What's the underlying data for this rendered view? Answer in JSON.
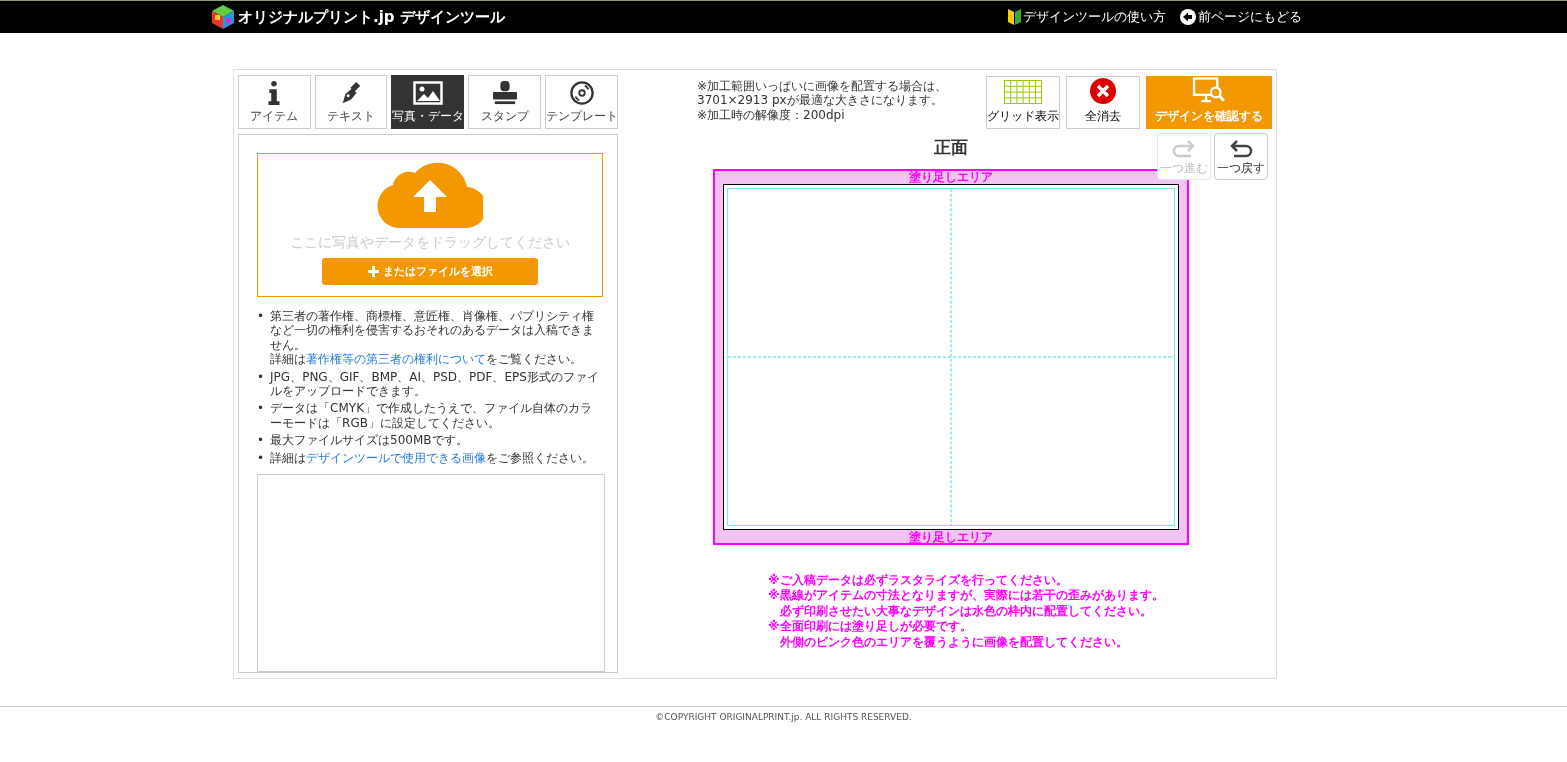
{
  "header": {
    "logo_text": "オリジナルプリント.jp デザインツール",
    "links": [
      {
        "kind": "guide",
        "label": "デザインツールの使い方"
      },
      {
        "kind": "back",
        "label": "前ページにもどる"
      }
    ]
  },
  "tabs": [
    {
      "kind": "info",
      "label": "アイテム",
      "selected": false
    },
    {
      "kind": "pen",
      "label": "テキスト",
      "selected": false
    },
    {
      "kind": "image",
      "label": "写真・データ",
      "selected": true
    },
    {
      "kind": "stamp",
      "label": "スタンプ",
      "selected": false
    },
    {
      "kind": "disc",
      "label": "テンプレート",
      "selected": false
    }
  ],
  "upload": {
    "drop_text": "ここに写真やデータをドラッグしてください",
    "button": "またはファイルを選択"
  },
  "rules": [
    {
      "bullet": "•",
      "lines": [
        [
          {
            "kind": "text",
            "text": "第三者の著作権、商標権、意匠権、肖像権、パブリシティ権など一切の権利を侵害するおそれのあるデータは入稿できません。"
          }
        ],
        [
          {
            "kind": "text",
            "text": "詳細は"
          },
          {
            "kind": "link",
            "text": "著作権等の第三者の権利について"
          },
          {
            "kind": "text",
            "text": "をご覧ください。"
          }
        ]
      ]
    },
    {
      "bullet": "•",
      "lines": [
        [
          {
            "kind": "text",
            "text": "JPG、PNG、GIF、BMP、AI、PSD、PDF、EPS形式のファイルをアップロードできます。"
          }
        ]
      ]
    },
    {
      "bullet": "•",
      "lines": [
        [
          {
            "kind": "text",
            "text": "データは「CMYK」で作成したうえで、ファイル自体のカラーモードは「RGB」に設定してください。"
          }
        ]
      ]
    },
    {
      "bullet": "•",
      "lines": [
        [
          {
            "kind": "text",
            "text": "最大ファイルサイズは500MBです。"
          }
        ]
      ]
    },
    {
      "bullet": "•",
      "lines": [
        [
          {
            "kind": "text",
            "text": "詳細は"
          },
          {
            "kind": "link",
            "text": "デザインツールで使用できる画像"
          },
          {
            "kind": "text",
            "text": "をご参照ください。"
          }
        ]
      ]
    }
  ],
  "info_notes": [
    "※加工範囲いっぱいに画像を配置する場合は、",
    "3701×2913 pxが最適な大きさになります。",
    "※加工時の解像度：200dpi"
  ],
  "tools": [
    {
      "kind": "grid",
      "label": "グリッド表示"
    },
    {
      "kind": "clear",
      "label": "全消去"
    },
    {
      "kind": "confirm",
      "label": "デザインを確認する"
    }
  ],
  "history": [
    {
      "kind": "redo",
      "label": "一つ進む",
      "disabled": true
    },
    {
      "kind": "undo",
      "label": "一つ戻す",
      "disabled": false
    }
  ],
  "canvas": {
    "side": "正面",
    "bleed_top": "塗り足しエリア",
    "bleed_bottom": "塗り足しエリア"
  },
  "warnings": [
    "※ご入稿データは必ずラスタライズを行ってください。",
    "※黒線がアイテムの寸法となりますが、実際には若干の歪みがあります。",
    "　必ず印刷させたい大事なデザインは水色の枠内に配置してください。",
    "※全面印刷には塗り足しが必要です。",
    "　外側のピンク色のエリアを覆うように画像を配置してください。"
  ],
  "footer": "©COPYRIGHT ORIGINALPRINT.jp. ALL RIGHTS RESERVED."
}
